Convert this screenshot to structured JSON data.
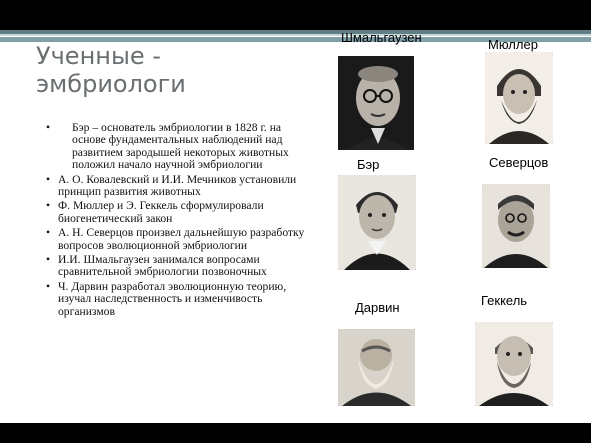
{
  "title": "Ученные - эмбриологи",
  "bullets": [
    "Бэр – основатель эмбриологии в 1828 г. на основе фундаментальных наблюдений над развитием зародышей некоторых животных положил начало научной эмбриологии",
    "А. О. Ковалевский и И.И. Мечников установили принцип развития животных",
    "Ф. Мюллер и Э.  Геккель сформулировали биогенетический закон",
    "А. Н. Северцов произвел дальнейшую разработку вопросов эволюционной эмбриологии",
    "И.И. Шмальгаузен занимался вопросами сравнительной эмбриологии позвоночных",
    "Ч. Дарвин  разработал эволюционную теорию, изучал наследственность и изменчивость организмов"
  ],
  "portraits": {
    "shmalgauzen": "Шмальгаузен",
    "myuller": "Мюллер",
    "ber": "Бэр",
    "severtsov": "Северцов",
    "darvin": "Дарвин",
    "gekkel": "Геккель"
  }
}
